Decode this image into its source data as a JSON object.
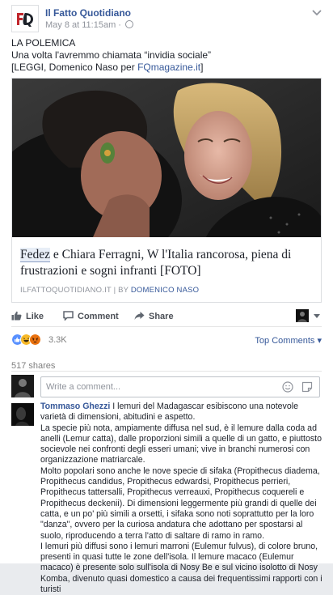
{
  "post": {
    "page_name": "Il Fatto Quotidiano",
    "timestamp": "May 8 at 11:15am",
    "text_line1": "LA POLEMICA",
    "text_line2": "Una volta l'avremmo chiamata “invidia sociale”",
    "text_line3_prefix": "[LEGGI, Domenico Naso per ",
    "text_line3_link": "FQmagazine.it",
    "text_line3_suffix": "]"
  },
  "link": {
    "title_highlight": "Fedez",
    "title_rest": " e Chiara Ferragni, W l'Italia rancorosa, piena di frustrazioni e sogni infranti [FOTO]",
    "source": "ILFATTOQUOTIDIANO.IT",
    "by_prefix": " | BY ",
    "author": "DOMENICO NASO"
  },
  "actions": {
    "like": "Like",
    "comment": "Comment",
    "share": "Share"
  },
  "reactions": {
    "count": "3.3K",
    "sort_label": "Top Comments",
    "colors": {
      "like": "#5890ff",
      "haha": "#f7b928",
      "angry": "#e9710f"
    }
  },
  "shares": "517 shares",
  "composer": {
    "placeholder": "Write a comment..."
  },
  "comment": {
    "author": "Tommaso Ghezzi",
    "paragraphs": [
      "I lemuri del Madagascar esibiscono una notevole varietà di dimensioni, abitudini e aspetto.",
      "La specie più nota, ampiamente diffusa nel sud, è il lemure dalla coda ad anelli (Lemur catta), dalle proporzioni simili a quelle di un gatto, e piuttosto socievole nei confronti degli esseri umani; vive in branchi numerosi con organizzazione matriarcale.",
      "Molto popolari sono anche le nove specie di sifaka (Propithecus diadema, Propithecus candidus, Propithecus edwardsi, Propithecus perrieri, Propithecus tattersalli, Propithecus verreauxi, Propithecus coquereli e Propithecus deckenii). Di dimensioni leggermente più grandi di quelle dei catta, e un po' più simili a orsetti, i sifaka sono noti soprattutto per la loro \"danza\", ovvero per la curiosa andatura che adottano per spostarsi al suolo, riproducendo a terra l'atto di saltare di ramo in ramo.",
      "I lemuri più diffusi sono i lemuri marroni (Eulemur fulvus), di colore bruno, presenti in quasi tutte le zone dell'isola. Il lemure macaco (Eulemur macaco) è presente solo sull'isola di Nosy Be e sul vicino isolotto di Nosy Komba, divenuto quasi domestico a causa dei frequentissimi rapporti con i turisti"
    ]
  }
}
